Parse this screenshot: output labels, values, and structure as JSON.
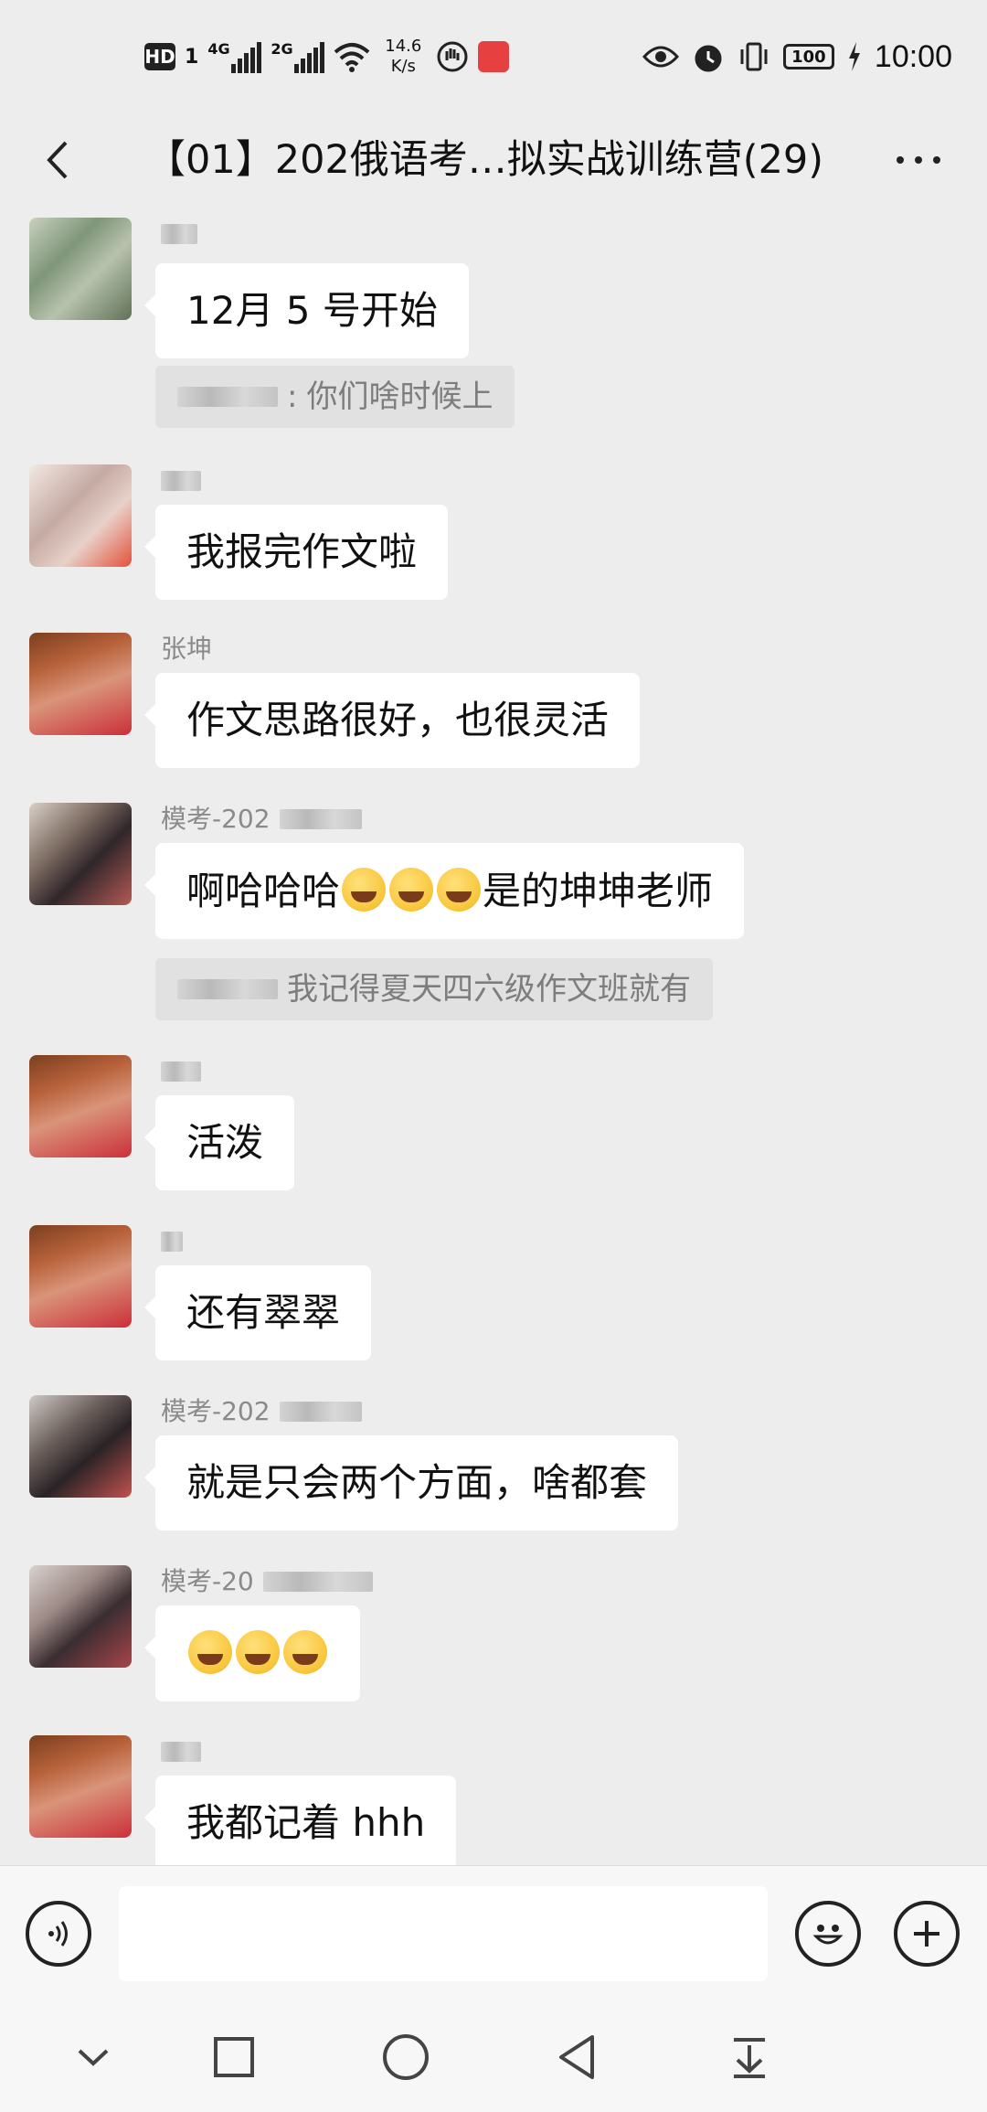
{
  "status_bar": {
    "hd_label": "HD",
    "sim_label": "1",
    "signal1_type": "4G",
    "signal2_type": "2G",
    "net_speed_value": "14.6",
    "net_speed_unit": "K/s",
    "battery": "100",
    "time": "10:00"
  },
  "header": {
    "title": "【01】202俄语考…拟实战训练营(29)"
  },
  "messages": [
    {
      "type": "text",
      "sender": "",
      "text": "12月 5 号开始"
    },
    {
      "type": "quote",
      "author_suffix": ":",
      "text": "你们啥时候上"
    },
    {
      "type": "text",
      "sender": "",
      "text": "我报完作文啦"
    },
    {
      "type": "text",
      "sender": "张坤",
      "text": "作文思路很好，也很灵活"
    },
    {
      "type": "text",
      "sender": "模考-202",
      "text_before": "啊哈哈哈",
      "emoji_count": 3,
      "emoji": "laugh-cry",
      "text_after": "是的坤坤老师"
    },
    {
      "type": "quote",
      "text": "我记得夏天四六级作文班就有"
    },
    {
      "type": "text",
      "sender": "",
      "text": "活泼"
    },
    {
      "type": "text",
      "sender": "",
      "text": "还有翠翠"
    },
    {
      "type": "text",
      "sender": "模考-202",
      "text": "就是只会两个方面，啥都套"
    },
    {
      "type": "emoji",
      "sender": "模考-20",
      "emoji": "facepalm",
      "emoji_count": 3
    },
    {
      "type": "text",
      "sender": "",
      "text": "我都记着 hhh"
    }
  ],
  "input_bar": {
    "placeholder": "",
    "icons": [
      "voice-icon",
      "emoji-icon",
      "plus-icon"
    ]
  },
  "nav_bar": {
    "icons": [
      "chevron-down-icon",
      "recents-icon",
      "home-icon",
      "back-triangle-icon",
      "download-icon"
    ]
  }
}
